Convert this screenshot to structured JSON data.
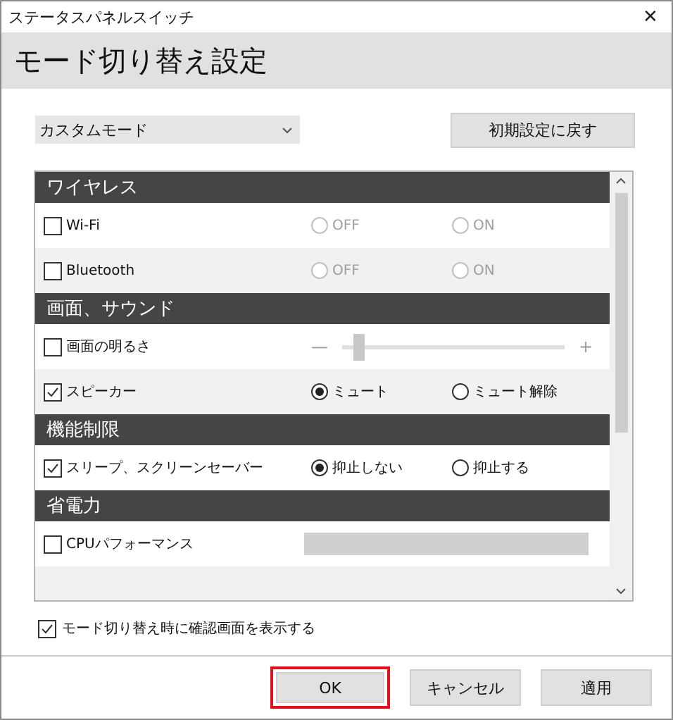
{
  "window": {
    "title": "ステータスパネルスイッチ",
    "close": "✕"
  },
  "header": {
    "title": "モード切り替え設定"
  },
  "mode_select": {
    "value": "カスタムモード"
  },
  "reset_button": "初期設定に戻す",
  "sections": [
    {
      "title": "ワイヤレス",
      "rows": [
        {
          "kind": "radio",
          "label": "Wi-Fi",
          "checked": false,
          "options": [
            {
              "label": "OFF",
              "selected": false,
              "disabled": true
            },
            {
              "label": "ON",
              "selected": false,
              "disabled": true
            }
          ]
        },
        {
          "kind": "radio",
          "label": "Bluetooth",
          "checked": false,
          "options": [
            {
              "label": "OFF",
              "selected": false,
              "disabled": true
            },
            {
              "label": "ON",
              "selected": false,
              "disabled": true
            }
          ]
        }
      ]
    },
    {
      "title": "画面、サウンド",
      "rows": [
        {
          "kind": "slider",
          "label": "画面の明るさ",
          "checked": false,
          "minus": "—",
          "plus": "+",
          "level": 0.05
        },
        {
          "kind": "radio",
          "label": "スピーカー",
          "checked": true,
          "options": [
            {
              "label": "ミュート",
              "selected": true,
              "disabled": false
            },
            {
              "label": "ミュート解除",
              "selected": false,
              "disabled": false
            }
          ]
        }
      ]
    },
    {
      "title": "機能制限",
      "rows": [
        {
          "kind": "radio",
          "label": "スリープ、スクリーンセーバー",
          "checked": true,
          "options": [
            {
              "label": "抑止しない",
              "selected": true,
              "disabled": false
            },
            {
              "label": "抑止する",
              "selected": false,
              "disabled": false
            }
          ]
        }
      ]
    },
    {
      "title": "省電力",
      "rows": [
        {
          "kind": "combo",
          "label": "CPUパフォーマンス",
          "checked": false
        }
      ]
    }
  ],
  "confirm": {
    "label": "モード切り替え時に確認画面を表示する",
    "checked": true
  },
  "buttons": [
    {
      "label": "OK",
      "selected": true
    },
    {
      "label": "キャンセル",
      "selected": false
    },
    {
      "label": "適用",
      "selected": false
    }
  ]
}
